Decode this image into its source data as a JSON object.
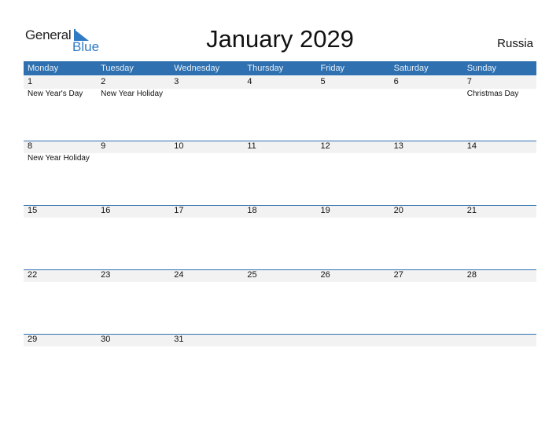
{
  "logo": {
    "word1": "General",
    "word2": "Blue"
  },
  "title": "January 2029",
  "country": "Russia",
  "colors": {
    "accent": "#2f70b0",
    "date_row_bg": "#f2f2f2"
  },
  "weekdays": [
    "Monday",
    "Tuesday",
    "Wednesday",
    "Thursday",
    "Friday",
    "Saturday",
    "Sunday"
  ],
  "weeks": [
    {
      "days": [
        "1",
        "2",
        "3",
        "4",
        "5",
        "6",
        "7"
      ],
      "events": [
        "New Year's Day",
        "New Year Holiday",
        "",
        "",
        "",
        "",
        "Christmas Day"
      ]
    },
    {
      "days": [
        "8",
        "9",
        "10",
        "11",
        "12",
        "13",
        "14"
      ],
      "events": [
        "New Year Holiday",
        "",
        "",
        "",
        "",
        "",
        ""
      ]
    },
    {
      "days": [
        "15",
        "16",
        "17",
        "18",
        "19",
        "20",
        "21"
      ],
      "events": [
        "",
        "",
        "",
        "",
        "",
        "",
        ""
      ]
    },
    {
      "days": [
        "22",
        "23",
        "24",
        "25",
        "26",
        "27",
        "28"
      ],
      "events": [
        "",
        "",
        "",
        "",
        "",
        "",
        ""
      ]
    },
    {
      "days": [
        "29",
        "30",
        "31",
        "",
        "",
        "",
        ""
      ],
      "events": [
        "",
        "",
        "",
        "",
        "",
        "",
        ""
      ]
    }
  ]
}
